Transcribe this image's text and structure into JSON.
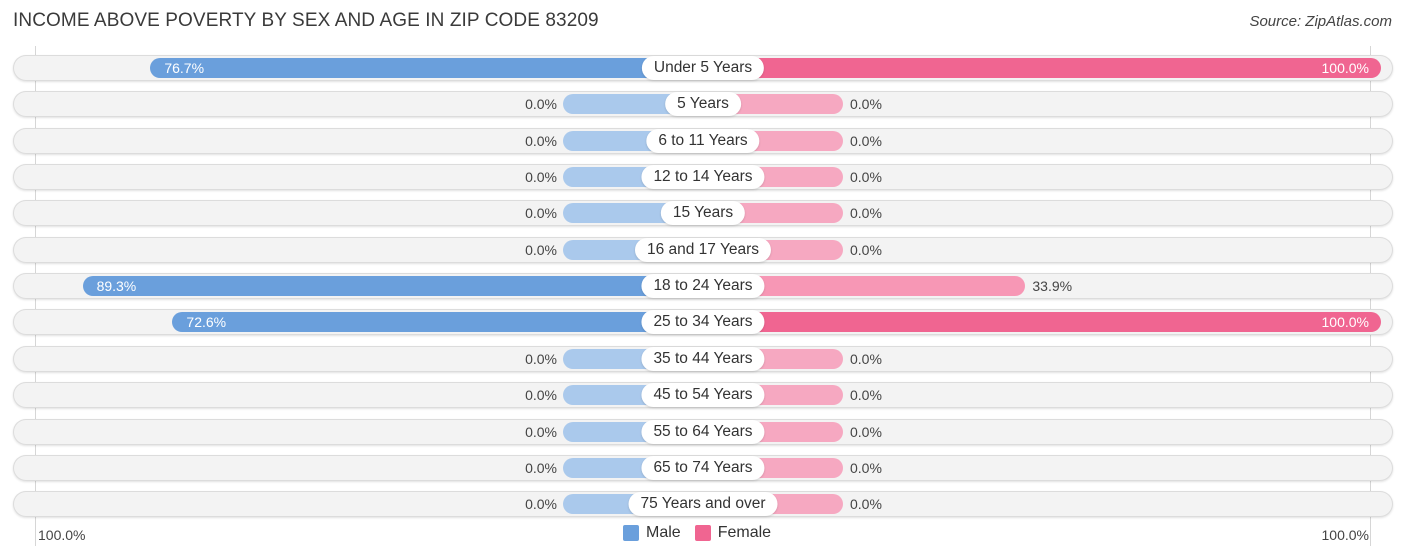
{
  "chart_data": {
    "type": "bar",
    "orientation": "horizontal-diverging",
    "title": "INCOME ABOVE POVERTY BY SEX AND AGE IN ZIP CODE 83209",
    "source": "Source: ZipAtlas.com",
    "categories": [
      "Under 5 Years",
      "5 Years",
      "6 to 11 Years",
      "12 to 14 Years",
      "15 Years",
      "16 and 17 Years",
      "18 to 24 Years",
      "25 to 34 Years",
      "35 to 44 Years",
      "45 to 54 Years",
      "55 to 64 Years",
      "65 to 74 Years",
      "75 Years and over"
    ],
    "series": [
      {
        "name": "Male",
        "values": [
          76.7,
          0.0,
          0.0,
          0.0,
          0.0,
          0.0,
          89.3,
          72.6,
          0.0,
          0.0,
          0.0,
          0.0,
          0.0
        ],
        "labels": [
          "76.7%",
          "0.0%",
          "0.0%",
          "0.0%",
          "0.0%",
          "0.0%",
          "89.3%",
          "72.6%",
          "0.0%",
          "0.0%",
          "0.0%",
          "0.0%",
          "0.0%"
        ]
      },
      {
        "name": "Female",
        "values": [
          100.0,
          0.0,
          0.0,
          0.0,
          0.0,
          0.0,
          33.9,
          100.0,
          0.0,
          0.0,
          0.0,
          0.0,
          0.0
        ],
        "labels": [
          "100.0%",
          "0.0%",
          "0.0%",
          "0.0%",
          "0.0%",
          "0.0%",
          "33.9%",
          "100.0%",
          "0.0%",
          "0.0%",
          "0.0%",
          "0.0%",
          "0.0%"
        ]
      }
    ],
    "xlim": [
      0,
      100
    ],
    "axis_left_label": "100.0%",
    "axis_right_label": "100.0%",
    "legend": {
      "position": "bottom-center",
      "items": [
        "Male",
        "Female"
      ]
    },
    "colors": {
      "male_strong": "#6a9fdc",
      "male_light": "#aac9ec",
      "female_strong": "#f06591",
      "female_medium": "#f797b5",
      "female_light": "#f6a8c1"
    }
  }
}
